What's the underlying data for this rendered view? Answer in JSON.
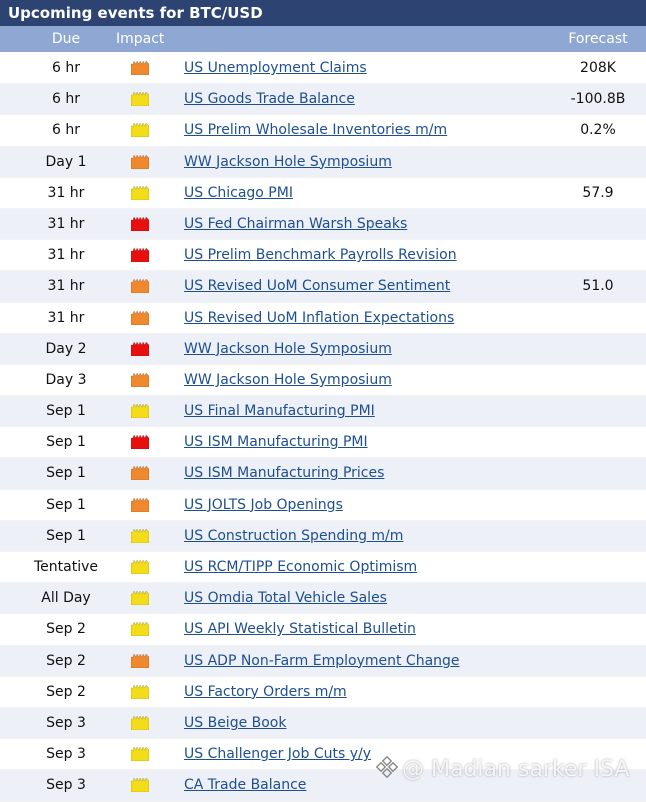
{
  "title": "Upcoming events for BTC/USD",
  "headers": {
    "due": "Due",
    "impact": "Impact",
    "forecast": "Forecast"
  },
  "colors": {
    "high": "#e8100e",
    "medium": "#f0892e",
    "low": "#f3dd1a"
  },
  "events": [
    {
      "due": "6 hr",
      "impact": "medium",
      "name": "US Unemployment Claims",
      "forecast": "208K"
    },
    {
      "due": "6 hr",
      "impact": "low",
      "name": "US Goods Trade Balance",
      "forecast": "-100.8B"
    },
    {
      "due": "6 hr",
      "impact": "low",
      "name": "US Prelim Wholesale Inventories m/m",
      "forecast": "0.2%"
    },
    {
      "due": "Day 1",
      "impact": "medium",
      "name": "WW Jackson Hole Symposium",
      "forecast": ""
    },
    {
      "due": "31 hr",
      "impact": "low",
      "name": "US Chicago PMI",
      "forecast": "57.9"
    },
    {
      "due": "31 hr",
      "impact": "high",
      "name": "US Fed Chairman Warsh Speaks",
      "forecast": ""
    },
    {
      "due": "31 hr",
      "impact": "high",
      "name": "US Prelim Benchmark Payrolls Revision",
      "forecast": ""
    },
    {
      "due": "31 hr",
      "impact": "medium",
      "name": "US Revised UoM Consumer Sentiment",
      "forecast": "51.0"
    },
    {
      "due": "31 hr",
      "impact": "medium",
      "name": "US Revised UoM Inflation Expectations",
      "forecast": ""
    },
    {
      "due": "Day 2",
      "impact": "high",
      "name": "WW Jackson Hole Symposium",
      "forecast": ""
    },
    {
      "due": "Day 3",
      "impact": "medium",
      "name": "WW Jackson Hole Symposium",
      "forecast": ""
    },
    {
      "due": "Sep 1",
      "impact": "low",
      "name": "US Final Manufacturing PMI",
      "forecast": ""
    },
    {
      "due": "Sep 1",
      "impact": "high",
      "name": "US ISM Manufacturing PMI",
      "forecast": ""
    },
    {
      "due": "Sep 1",
      "impact": "medium",
      "name": "US ISM Manufacturing Prices",
      "forecast": ""
    },
    {
      "due": "Sep 1",
      "impact": "medium",
      "name": "US JOLTS Job Openings",
      "forecast": ""
    },
    {
      "due": "Sep 1",
      "impact": "low",
      "name": "US Construction Spending m/m",
      "forecast": ""
    },
    {
      "due": "Tentative",
      "impact": "low",
      "name": "US RCM/TIPP Economic Optimism",
      "forecast": ""
    },
    {
      "due": "All Day",
      "impact": "low",
      "name": "US Omdia Total Vehicle Sales",
      "forecast": ""
    },
    {
      "due": "Sep 2",
      "impact": "low",
      "name": "US API Weekly Statistical Bulletin",
      "forecast": ""
    },
    {
      "due": "Sep 2",
      "impact": "medium",
      "name": "US ADP Non-Farm Employment Change",
      "forecast": ""
    },
    {
      "due": "Sep 2",
      "impact": "low",
      "name": "US Factory Orders m/m",
      "forecast": ""
    },
    {
      "due": "Sep 3",
      "impact": "low",
      "name": "US Beige Book",
      "forecast": ""
    },
    {
      "due": "Sep 3",
      "impact": "low",
      "name": "US Challenger Job Cuts y/y",
      "forecast": ""
    },
    {
      "due": "Sep 3",
      "impact": "low",
      "name": "CA Trade Balance",
      "forecast": ""
    }
  ],
  "watermark": "@ Madian sarker ISA"
}
